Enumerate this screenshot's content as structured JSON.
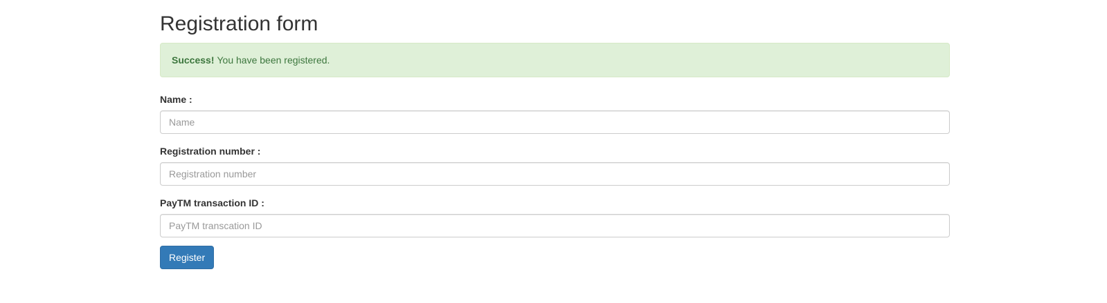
{
  "page": {
    "title": "Registration form"
  },
  "alert": {
    "strong": "Success!",
    "message": "You have been registered."
  },
  "form": {
    "name": {
      "label": "Name :",
      "placeholder": "Name",
      "value": ""
    },
    "registration": {
      "label": "Registration number :",
      "placeholder": "Registration number",
      "value": ""
    },
    "paytm": {
      "label": "PayTM transaction ID :",
      "placeholder": "PayTM transcation ID",
      "value": ""
    },
    "submit_label": "Register"
  },
  "colors": {
    "success_bg": "#dff0d8",
    "success_text": "#3c763d",
    "primary": "#337ab7"
  }
}
